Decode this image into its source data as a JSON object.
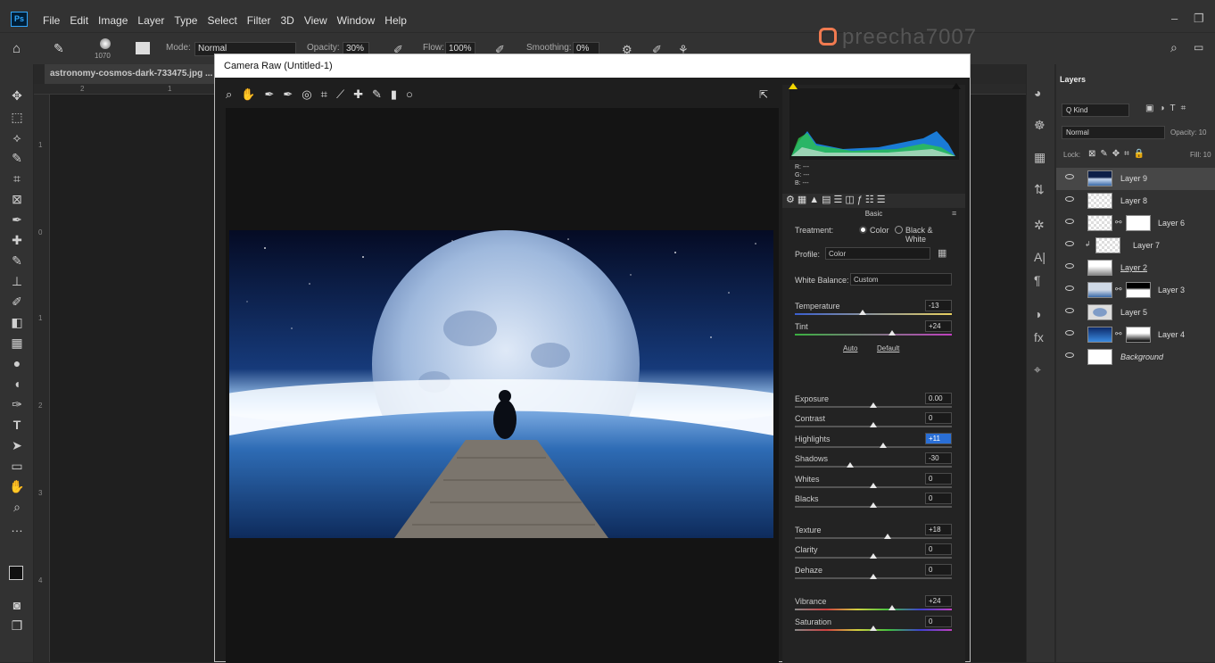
{
  "app": {
    "logo": "Ps"
  },
  "menu": [
    "File",
    "Edit",
    "Image",
    "Layer",
    "Type",
    "Select",
    "Filter",
    "3D",
    "View",
    "Window",
    "Help"
  ],
  "options": {
    "brush_size": "1070",
    "mode_label": "Mode:",
    "mode_value": "Normal",
    "opacity_label": "Opacity:",
    "opacity_value": "30%",
    "flow_label": "Flow:",
    "flow_value": "100%",
    "smoothing_label": "Smoothing:",
    "smoothing_value": "0%"
  },
  "watermark": {
    "handle": "preecha7007"
  },
  "document": {
    "tab_title": "astronomy-cosmos-dark-733475.jpg ..."
  },
  "rulers": {
    "h": [
      "2",
      "1"
    ],
    "v": [
      "1",
      "0",
      "1",
      "2",
      "3",
      "4"
    ]
  },
  "camera_raw": {
    "title": "Camera Raw (Untitled-1)",
    "rgb": {
      "r": "R:  ---",
      "g": "G:  ---",
      "b": "B:  ---"
    },
    "section": "Basic",
    "treatment_label": "Treatment:",
    "treatment_color": "Color",
    "treatment_bw": "Black & White",
    "profile_label": "Profile:",
    "profile_value": "Color",
    "wb_label": "White Balance:",
    "wb_value": "Custom",
    "auto": "Auto",
    "default": "Default",
    "sliders": [
      {
        "label": "Temperature",
        "value": "-13",
        "pos": 0.43
      },
      {
        "label": "Tint",
        "value": "+24",
        "pos": 0.62
      },
      {
        "label": "Exposure",
        "value": "0.00",
        "pos": 0.5
      },
      {
        "label": "Contrast",
        "value": "0",
        "pos": 0.5
      },
      {
        "label": "Highlights",
        "value": "+11",
        "pos": 0.56
      },
      {
        "label": "Shadows",
        "value": "-30",
        "pos": 0.35
      },
      {
        "label": "Whites",
        "value": "0",
        "pos": 0.5
      },
      {
        "label": "Blacks",
        "value": "0",
        "pos": 0.5
      },
      {
        "label": "Texture",
        "value": "+18",
        "pos": 0.59
      },
      {
        "label": "Clarity",
        "value": "0",
        "pos": 0.5
      },
      {
        "label": "Dehaze",
        "value": "0",
        "pos": 0.5
      },
      {
        "label": "Vibrance",
        "value": "+24",
        "pos": 0.62
      },
      {
        "label": "Saturation",
        "value": "0",
        "pos": 0.5
      }
    ]
  },
  "layers_panel": {
    "tab": "Layers",
    "kind_label": "Q Kind",
    "blend_mode": "Normal",
    "opacity_label": "Opacity: 10",
    "lock_label": "Lock:",
    "fill_label": "Fill: 10",
    "layers": [
      {
        "name": "Layer 9",
        "selected": true
      },
      {
        "name": "Layer 8"
      },
      {
        "name": "Layer 6"
      },
      {
        "name": "Layer 7"
      },
      {
        "name": "Layer 2"
      },
      {
        "name": "Layer 3"
      },
      {
        "name": "Layer 5"
      },
      {
        "name": "Layer 4"
      },
      {
        "name": "Background"
      }
    ]
  }
}
